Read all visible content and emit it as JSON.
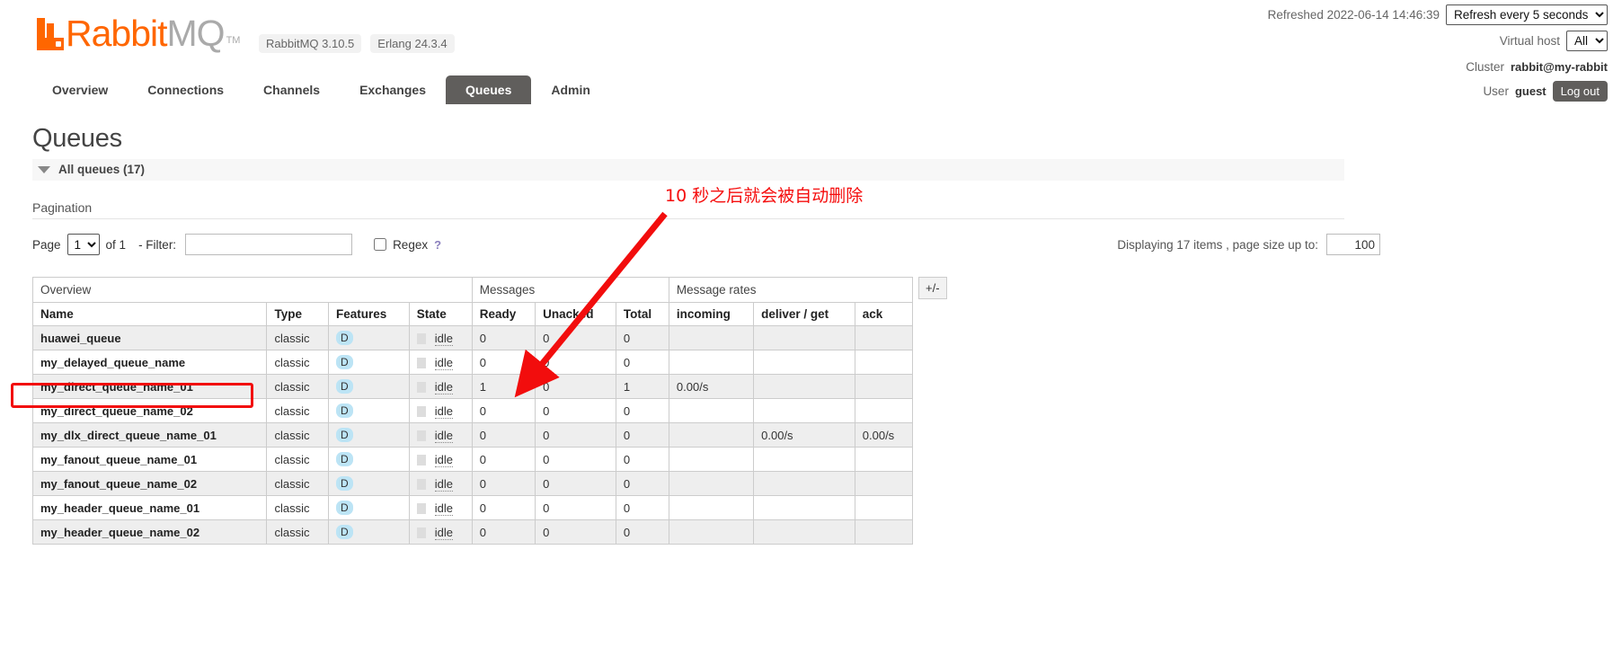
{
  "header": {
    "logo": {
      "rabbit": "Rabbit",
      "mq": "MQ",
      "tm": "TM"
    },
    "versions": [
      {
        "label": "RabbitMQ 3.10.5"
      },
      {
        "label": "Erlang 24.3.4"
      }
    ],
    "tabs": [
      {
        "label": "Overview",
        "active": false
      },
      {
        "label": "Connections",
        "active": false
      },
      {
        "label": "Channels",
        "active": false
      },
      {
        "label": "Exchanges",
        "active": false
      },
      {
        "label": "Queues",
        "active": true
      },
      {
        "label": "Admin",
        "active": false
      }
    ],
    "refreshed_label": "Refreshed 2022-06-14 14:46:39",
    "refresh_select": "Refresh every 5 seconds",
    "vhost_label": "Virtual host",
    "vhost_select": "All",
    "cluster_label": "Cluster",
    "cluster_name": "rabbit@my-rabbit",
    "user_label": "User",
    "user_name": "guest",
    "logout_label": "Log out"
  },
  "main": {
    "page_title": "Queues",
    "section_title": "All queues (17)",
    "pagination_label": "Pagination",
    "page_label": "Page",
    "page_value": "1",
    "of_label": "of 1",
    "filter_label": "- Filter:",
    "filter_value": "",
    "filter_placeholder": "",
    "regex_label": "Regex",
    "regex_help": "?",
    "displaying_label": "Displaying 17 items , page size up to:",
    "page_size_value": "100",
    "plus_minus_label": "+/-"
  },
  "table": {
    "group_headers": [
      {
        "label": "Overview",
        "span": 4
      },
      {
        "label": "Messages",
        "span": 3
      },
      {
        "label": "Message rates",
        "span": 3
      }
    ],
    "columns": [
      "Name",
      "Type",
      "Features",
      "State",
      "Ready",
      "Unacked",
      "Total",
      "incoming",
      "deliver / get",
      "ack"
    ],
    "rows": [
      {
        "name": "huawei_queue",
        "type": "classic",
        "features": "D",
        "state": "idle",
        "ready": "0",
        "unacked": "0",
        "total": "0",
        "incoming": "",
        "deliver": "",
        "ack": ""
      },
      {
        "name": "my_delayed_queue_name",
        "type": "classic",
        "features": "D",
        "state": "idle",
        "ready": "0",
        "unacked": "0",
        "total": "0",
        "incoming": "",
        "deliver": "",
        "ack": ""
      },
      {
        "name": "my_direct_queue_name_01",
        "type": "classic",
        "features": "D",
        "state": "idle",
        "ready": "1",
        "unacked": "0",
        "total": "1",
        "incoming": "0.00/s",
        "deliver": "",
        "ack": ""
      },
      {
        "name": "my_direct_queue_name_02",
        "type": "classic",
        "features": "D",
        "state": "idle",
        "ready": "0",
        "unacked": "0",
        "total": "0",
        "incoming": "",
        "deliver": "",
        "ack": ""
      },
      {
        "name": "my_dlx_direct_queue_name_01",
        "type": "classic",
        "features": "D",
        "state": "idle",
        "ready": "0",
        "unacked": "0",
        "total": "0",
        "incoming": "",
        "deliver": "0.00/s",
        "ack": "0.00/s"
      },
      {
        "name": "my_fanout_queue_name_01",
        "type": "classic",
        "features": "D",
        "state": "idle",
        "ready": "0",
        "unacked": "0",
        "total": "0",
        "incoming": "",
        "deliver": "",
        "ack": ""
      },
      {
        "name": "my_fanout_queue_name_02",
        "type": "classic",
        "features": "D",
        "state": "idle",
        "ready": "0",
        "unacked": "0",
        "total": "0",
        "incoming": "",
        "deliver": "",
        "ack": ""
      },
      {
        "name": "my_header_queue_name_01",
        "type": "classic",
        "features": "D",
        "state": "idle",
        "ready": "0",
        "unacked": "0",
        "total": "0",
        "incoming": "",
        "deliver": "",
        "ack": ""
      },
      {
        "name": "my_header_queue_name_02",
        "type": "classic",
        "features": "D",
        "state": "idle",
        "ready": "0",
        "unacked": "0",
        "total": "0",
        "incoming": "",
        "deliver": "",
        "ack": ""
      }
    ]
  },
  "annotation": {
    "text": "10 秒之后就会被自动删除",
    "color": "#f50d0d",
    "highlight_target": "my_direct_queue_name_01"
  },
  "colors": {
    "brand_orange": "#ff6600",
    "tab_active_bg": "#605e5c",
    "badge_blue": "#bce4f5",
    "annotation_red": "#f50d0d"
  }
}
